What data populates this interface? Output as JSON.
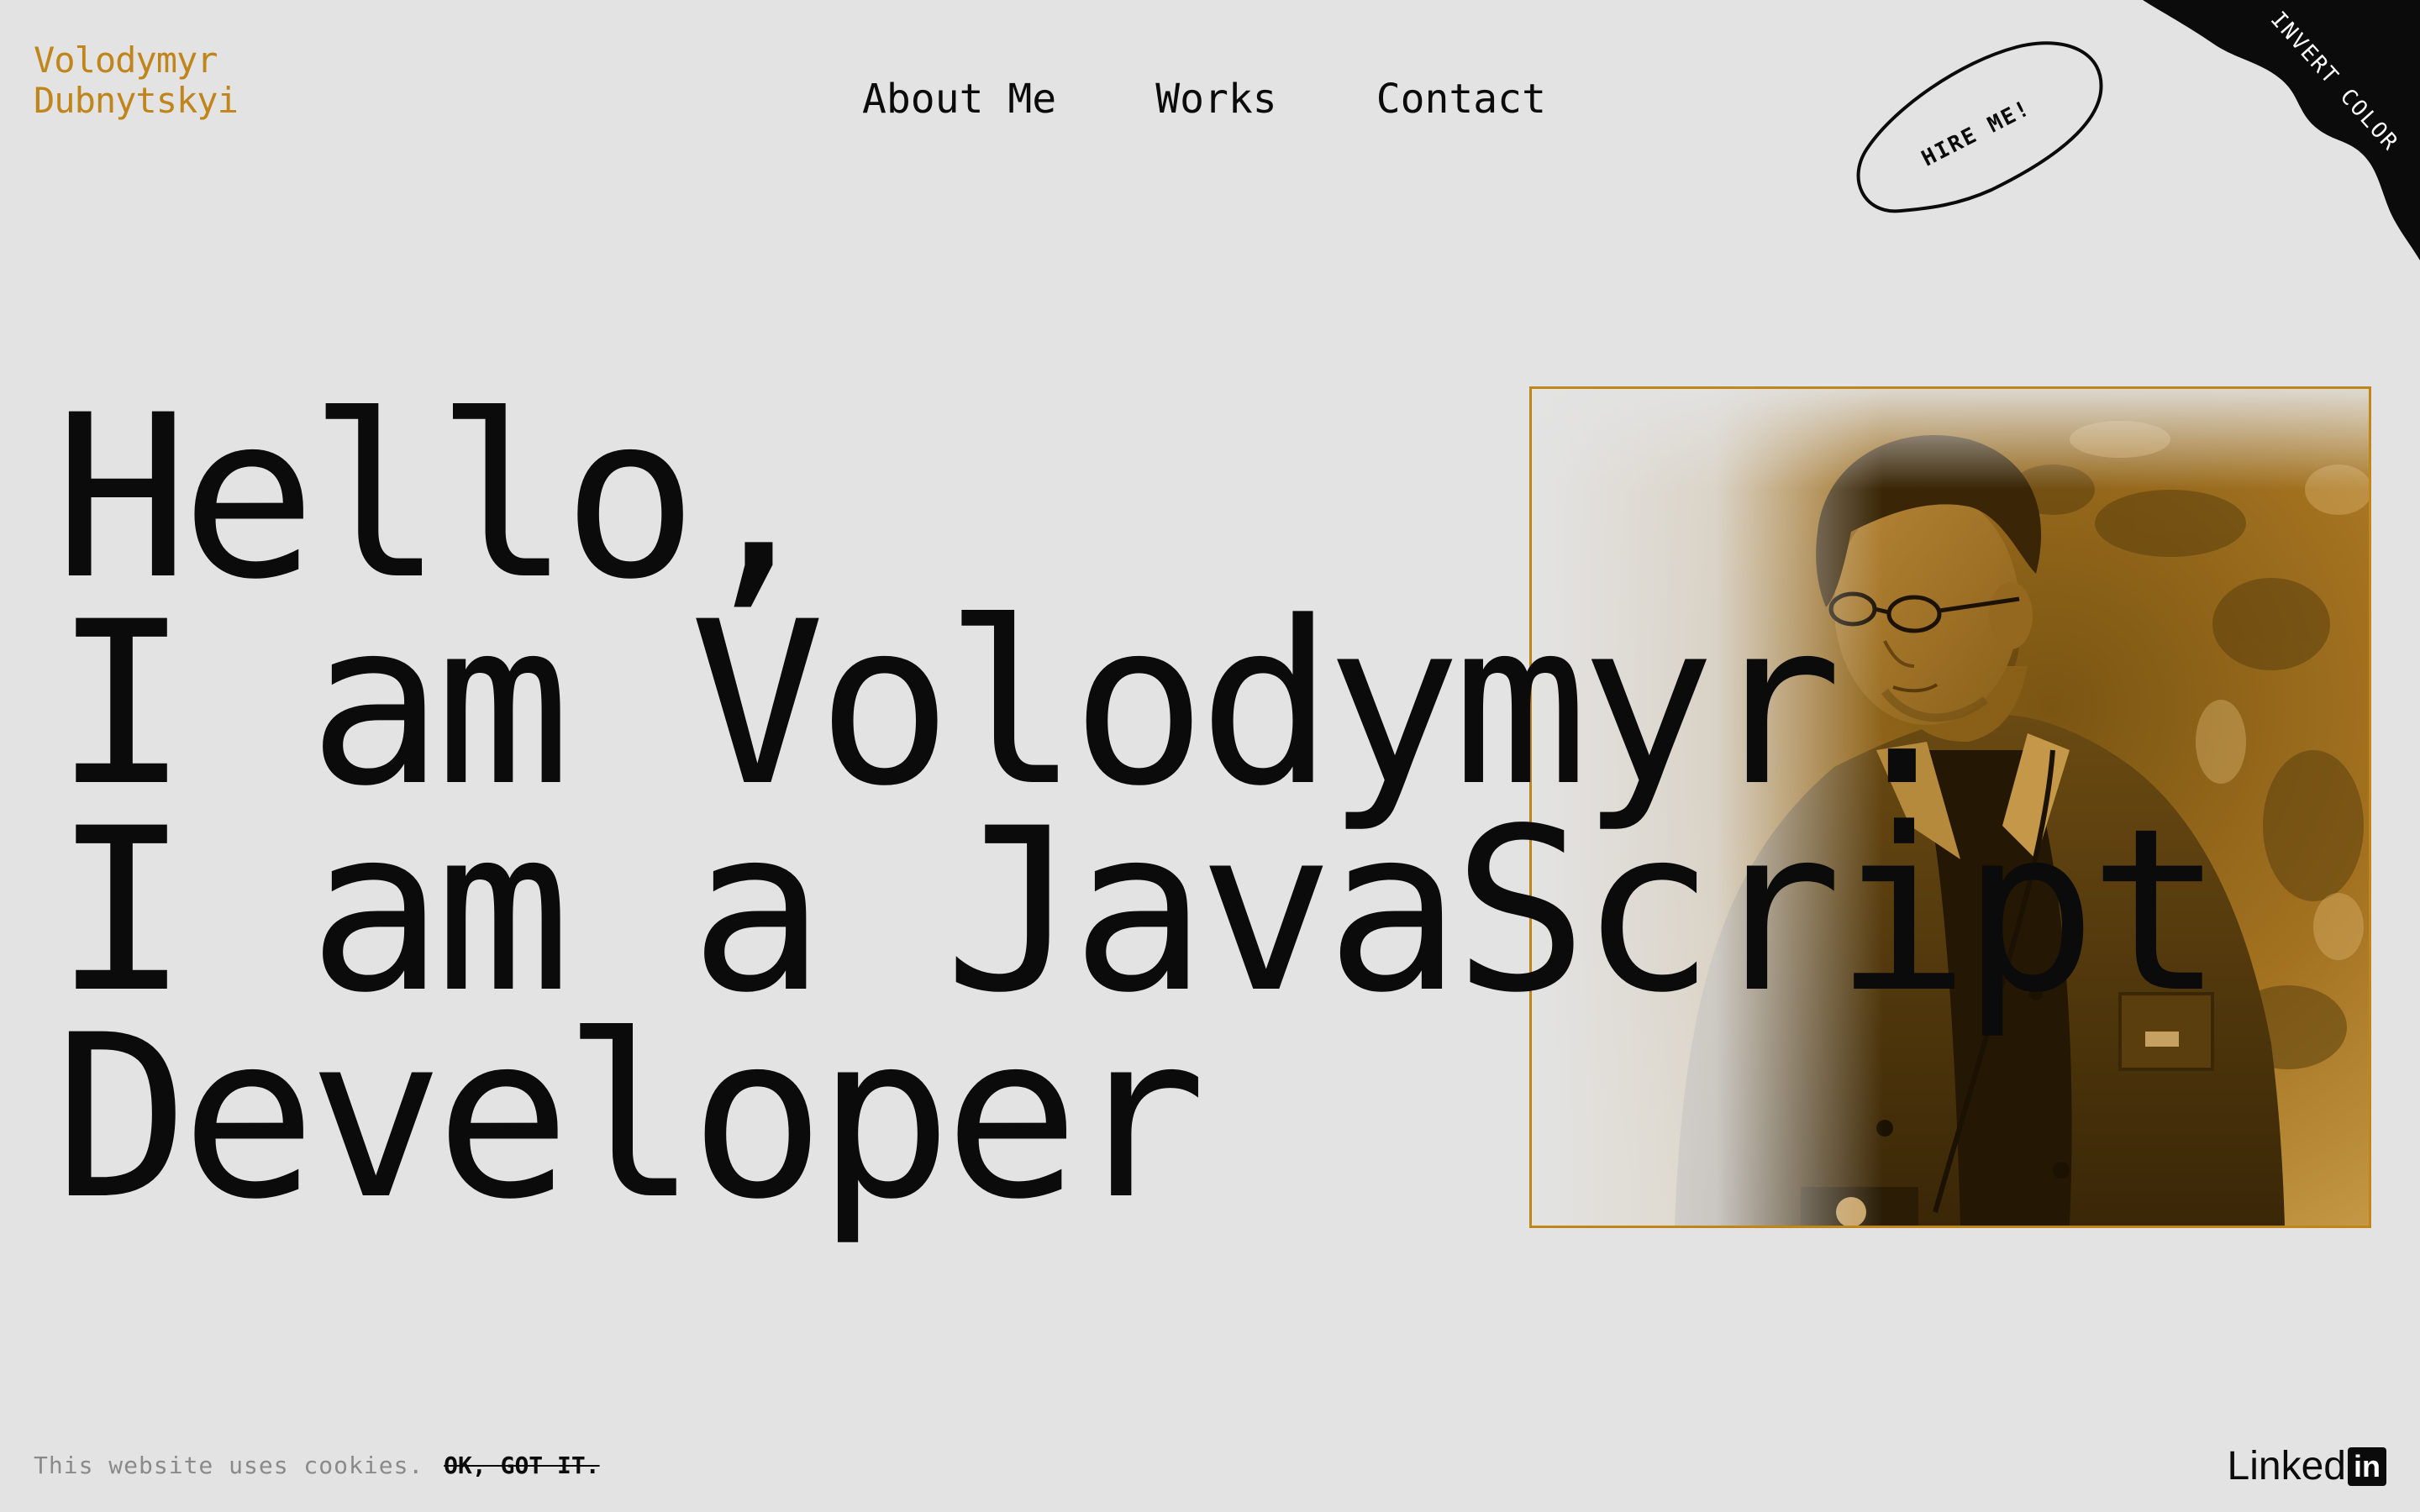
{
  "brand": {
    "first_name": "Volodymyr",
    "last_name": "Dubnytskyi"
  },
  "nav": {
    "items": [
      {
        "label": "About Me"
      },
      {
        "label": "Works"
      },
      {
        "label": "Contact"
      }
    ]
  },
  "hire_badge": {
    "label": "HIRE ME!"
  },
  "invert_corner": {
    "label": "INVERT COLOR"
  },
  "hero": {
    "lines": [
      "Hello,",
      "I am Volodymyr.",
      "I am a JavaScript",
      "Developer"
    ]
  },
  "cookie_banner": {
    "text": "This website uses cookies.",
    "ok_label": "OK, GOT IT."
  },
  "social": {
    "linkedin_text": "Linked",
    "linkedin_box": "in"
  },
  "colors": {
    "background": "#e3e3e3",
    "accent": "#c0851b",
    "text": "#0b0b0b",
    "muted": "#8a8a8a"
  }
}
